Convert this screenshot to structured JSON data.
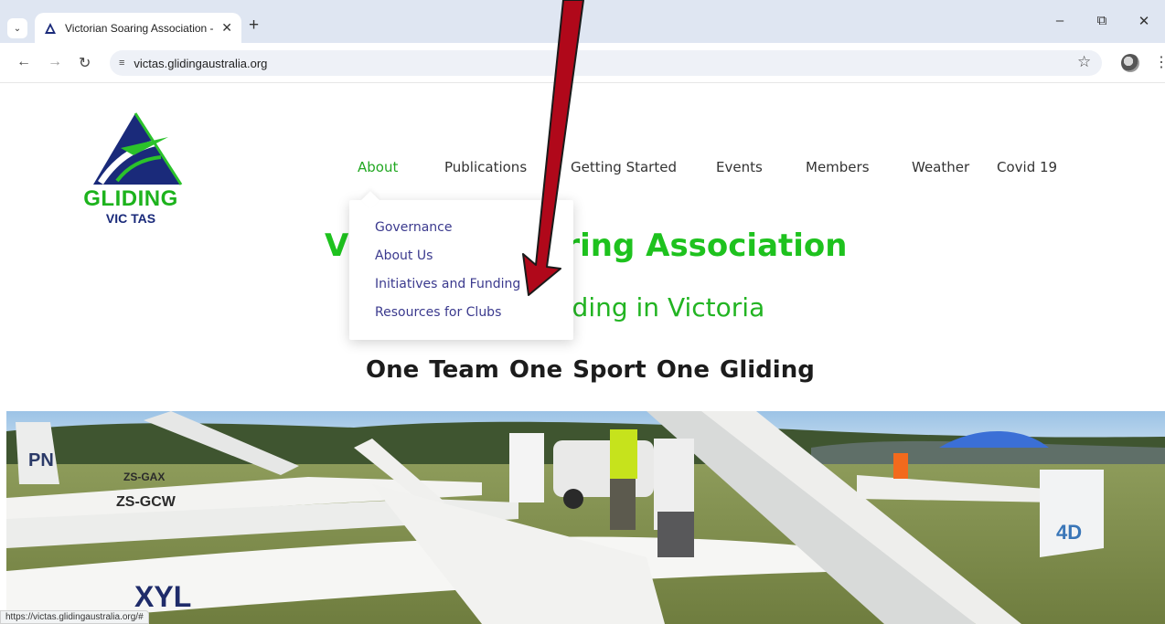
{
  "browser": {
    "tab_title": "Victorian Soaring Association -",
    "tab_close": "✕",
    "new_tab": "+",
    "url": "victas.glidingaustralia.org",
    "status_url": "https://victas.glidingaustralia.org/#",
    "window_controls": {
      "minimize": "–",
      "restore": "⧉",
      "close": "✕"
    }
  },
  "logo": {
    "word": "GLIDING",
    "sub": "VIC TAS"
  },
  "nav": {
    "items": [
      "About",
      "Publications",
      "Getting Started",
      "Events",
      "Members",
      "Weather",
      "Covid 19"
    ],
    "active": "About"
  },
  "dropdown": {
    "items": [
      "Governance",
      "About Us",
      "Initiatives and Funding",
      "Resources for Clubs"
    ]
  },
  "hero": {
    "title_visible": "ring Association",
    "title_lead": "V",
    "subtitle_visible": "liding in Victoria",
    "tagline": "One Team  One Sport  One Gliding"
  },
  "photo": {
    "registrations": [
      "PN",
      "ZS-GAX",
      "ZS-GCW",
      "XYL",
      "4D"
    ]
  },
  "colors": {
    "brand_green": "#1ec21e",
    "nav_active": "#22a822",
    "dropdown_link": "#3b3a8e",
    "logo_blue": "#1a2a7a",
    "arrow": "#b0081a"
  },
  "icons": [
    "tab-search-icon",
    "site-favicon",
    "back-icon",
    "forward-icon",
    "reload-icon",
    "site-info-icon",
    "bookmark-star-icon",
    "profile-avatar",
    "menu-kebab-icon",
    "annotation-arrow"
  ]
}
